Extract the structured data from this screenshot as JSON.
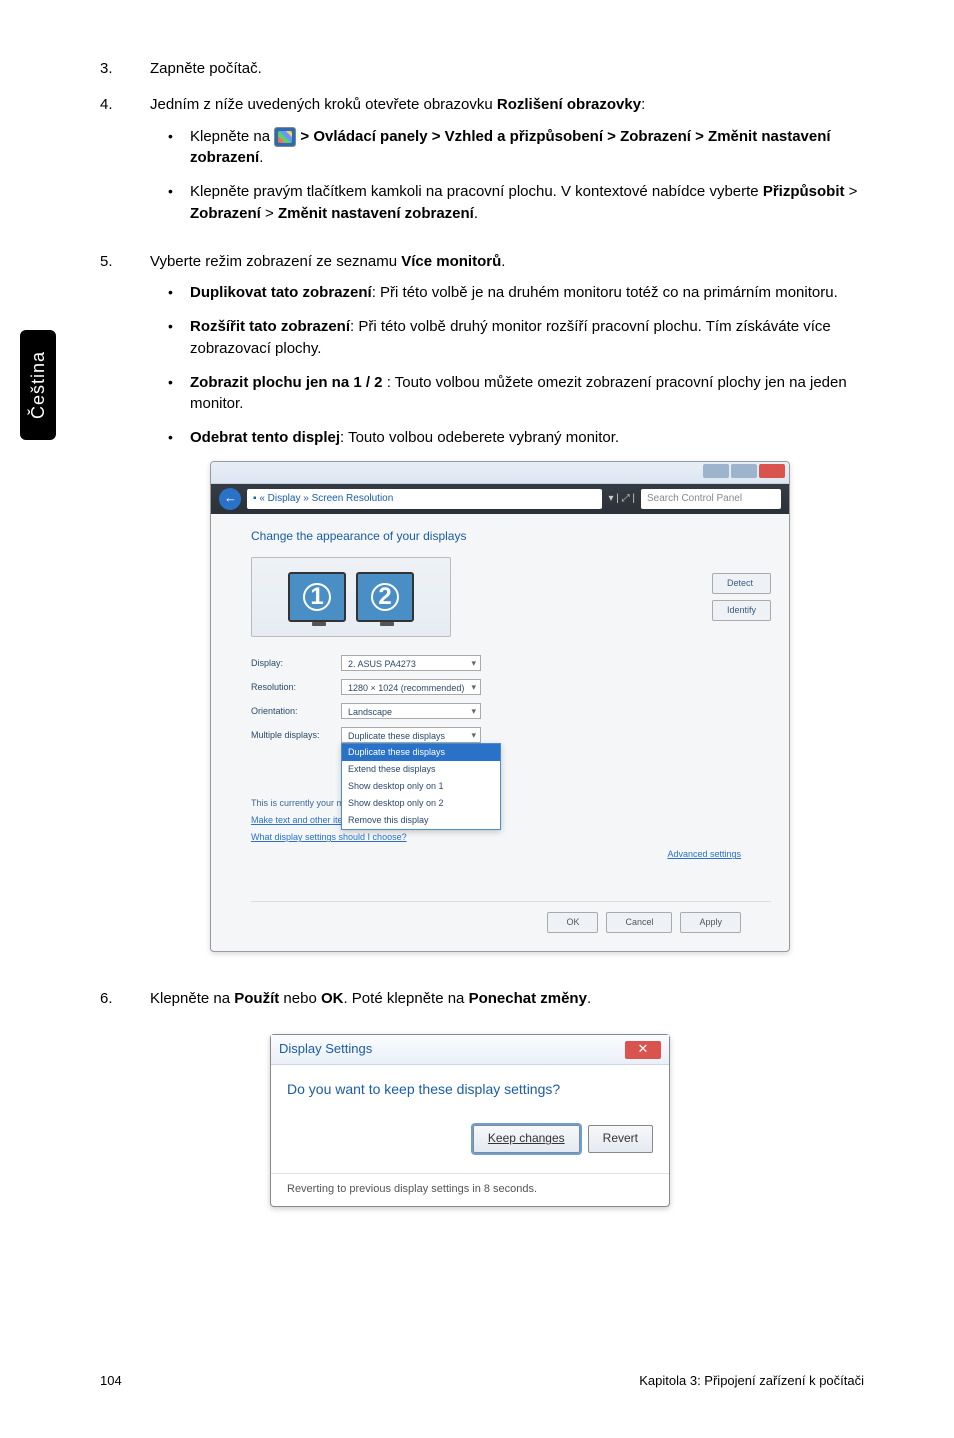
{
  "side_tab": "Čeština",
  "steps": {
    "s3": {
      "num": "3.",
      "text": "Zapněte počítač."
    },
    "s4": {
      "num": "4.",
      "intro_a": "Jedním z níže uvedených kroků otevřete obrazovku ",
      "intro_b": "Rozlišení obrazovky",
      "intro_c": ":",
      "items": [
        {
          "pre": "Klepněte na ",
          "chain": " > Ovládací panely > Vzhled a přizpůsobení > Zobrazení > Změnit nastavení zobrazení",
          "post": "."
        },
        {
          "line1": "Klepněte pravým tlačítkem kamkoli na pracovní plochu. V kontextové nabídce vyberte ",
          "b1": "Přizpůsobit",
          "gt1": " > ",
          "b2": "Zobrazení",
          "gt2": " > ",
          "b3": "Změnit nastavení zobrazení",
          "post": "."
        }
      ]
    },
    "s5": {
      "num": "5.",
      "intro_a": "Vyberte režim zobrazení ze seznamu ",
      "intro_b": "Více monitorů",
      "intro_c": ".",
      "items": [
        {
          "b": "Duplikovat tato zobrazení",
          "t": ": Při této volbě je na druhém monitoru totéž co na primárním monitoru."
        },
        {
          "b": "Rozšířit tato zobrazení",
          "t": ": Při této volbě druhý monitor rozšíří pracovní plochu. Tím získáváte více zobrazovací plochy."
        },
        {
          "b": "Zobrazit plochu jen na 1 / 2",
          "t": " : Touto volbou můžete omezit zobrazení pracovní plochy jen na jeden monitor."
        },
        {
          "b": "Odebrat tento displej",
          "t": ": Touto volbou odeberete vybraný monitor."
        }
      ]
    },
    "s6": {
      "num": "6.",
      "a": "Klepněte na ",
      "b1": "Použít",
      "mid": " nebo ",
      "b2": "OK",
      "c": ". Poté klepněte na ",
      "b3": "Ponechat změny",
      "d": "."
    }
  },
  "fig1": {
    "breadcrumb": "▪ « Display » Screen Resolution",
    "search_sep": "▾ | ⤢ |",
    "search_placeholder": "Search Control Panel",
    "heading": "Change the appearance of your displays",
    "mon1": "1",
    "mon2": "2",
    "btn_detect": "Detect",
    "btn_identify": "Identify",
    "rows": {
      "display": {
        "lbl": "Display:",
        "val": "2. ASUS PA4273"
      },
      "resolution": {
        "lbl": "Resolution:",
        "val": "1280 × 1024 (recommended)"
      },
      "orientation": {
        "lbl": "Orientation:",
        "val": "Landscape"
      },
      "multiple": {
        "lbl": "Multiple displays:",
        "val": "Duplicate these displays"
      }
    },
    "dd": {
      "o1": "Duplicate these displays",
      "o2": "Extend these displays",
      "o3": "Show desktop only on 1",
      "o4": "Show desktop only on 2",
      "o5": "Remove this display"
    },
    "aux1": "This is currently your main display.",
    "aux2": "Make text and other items larger or smaller",
    "aux3": "What display settings should I choose?",
    "adv": "Advanced settings",
    "ok": "OK",
    "cancel": "Cancel",
    "apply": "Apply"
  },
  "fig2": {
    "title": "Display Settings",
    "msg": "Do you want to keep these display settings?",
    "keep": "Keep changes",
    "revert": "Revert",
    "footer": "Reverting to previous display settings in 8 seconds."
  },
  "footer": {
    "page": "104",
    "chapter": "Kapitola 3: Připojení zařízení k počítači"
  },
  "chart_data": null
}
